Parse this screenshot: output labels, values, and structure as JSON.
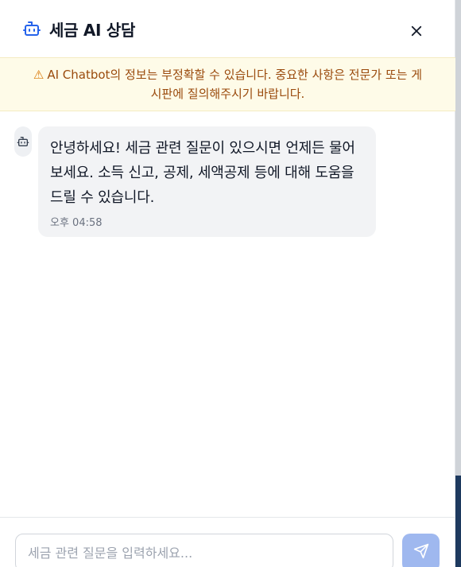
{
  "header": {
    "title": "세금 AI 상담",
    "icon": "bot-icon",
    "close_icon": "close-icon"
  },
  "notice": {
    "icon": "warning-icon",
    "line1": "AI Chatbot의 정보는 부정확할 수 있습니다. 중요한 사항은 전문가 또는 게",
    "line2": "시판에 질의해주시기 바랍니다."
  },
  "messages": [
    {
      "sender": "bot",
      "avatar_icon": "bot-icon",
      "text": "안녕하세요! 세금 관련 질문이 있으시면 언제든 물어보세요. 소득 신고, 공제, 세액공제 등에 대해 도움을 드릴 수 있습니다.",
      "time": "오후 04:58"
    }
  ],
  "composer": {
    "placeholder": "세금 관련 질문을 입력하세요...",
    "value": "",
    "send_icon": "send-icon"
  },
  "colors": {
    "accent": "#2563eb",
    "send_button": "#9fb8ef",
    "notice_bg": "#fefbe8",
    "notice_text": "#9a4a0c",
    "bubble_bg": "#f2f3f5"
  }
}
